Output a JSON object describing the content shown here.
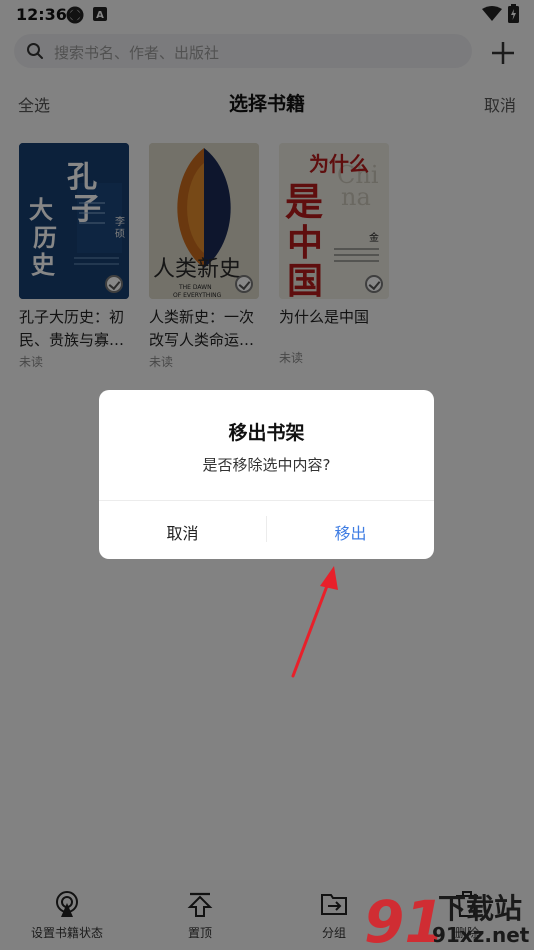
{
  "status_bar": {
    "time": "12:36",
    "icons": [
      "sync-icon",
      "a-badge-icon",
      "wifi-icon",
      "battery-charging-icon"
    ]
  },
  "search": {
    "placeholder": "搜索书名、作者、出版社",
    "add_icon": "plus-icon"
  },
  "header": {
    "select_all": "全选",
    "title": "选择书籍",
    "cancel": "取消"
  },
  "books": [
    {
      "title": "孔子大历史：初民、贵族与寡…",
      "title_lines": [
        "孔子大历史：初",
        "民、贵族与寡…"
      ],
      "status": "未读",
      "cover_text": "孔子大历史",
      "author": "李硕",
      "selected": true
    },
    {
      "title": "人类新史：一次改写人类命运…",
      "title_lines": [
        "人类新史：一次",
        "改写人类命运…"
      ],
      "status": "未读",
      "cover_text": "人类新史",
      "cover_sub": "THE DAWN OF EVERYTHING",
      "selected": true
    },
    {
      "title": "为什么是中国",
      "title_lines": [
        "为什么是中国"
      ],
      "status": "未读",
      "cover_text": "为什么是中国",
      "cover_sub": "China",
      "author": "金一南",
      "selected": true
    }
  ],
  "dialog": {
    "title": "移出书架",
    "message": "是否移除选中内容?",
    "cancel": "取消",
    "confirm": "移出"
  },
  "bottom_bar": [
    {
      "label": "设置书籍状态",
      "icon": "book-status-icon"
    },
    {
      "label": "置顶",
      "icon": "pin-top-icon"
    },
    {
      "label": "分组",
      "icon": "folder-move-icon"
    },
    {
      "label": "删除",
      "icon": "trash-icon"
    }
  ],
  "watermark": {
    "brand": "下载站",
    "site": "91xz.net",
    "logo": "91"
  },
  "colors": {
    "accent": "#3f7de3",
    "annotation_arrow": "#e8202a",
    "overlay": "rgba(0,0,0,0.47)"
  }
}
